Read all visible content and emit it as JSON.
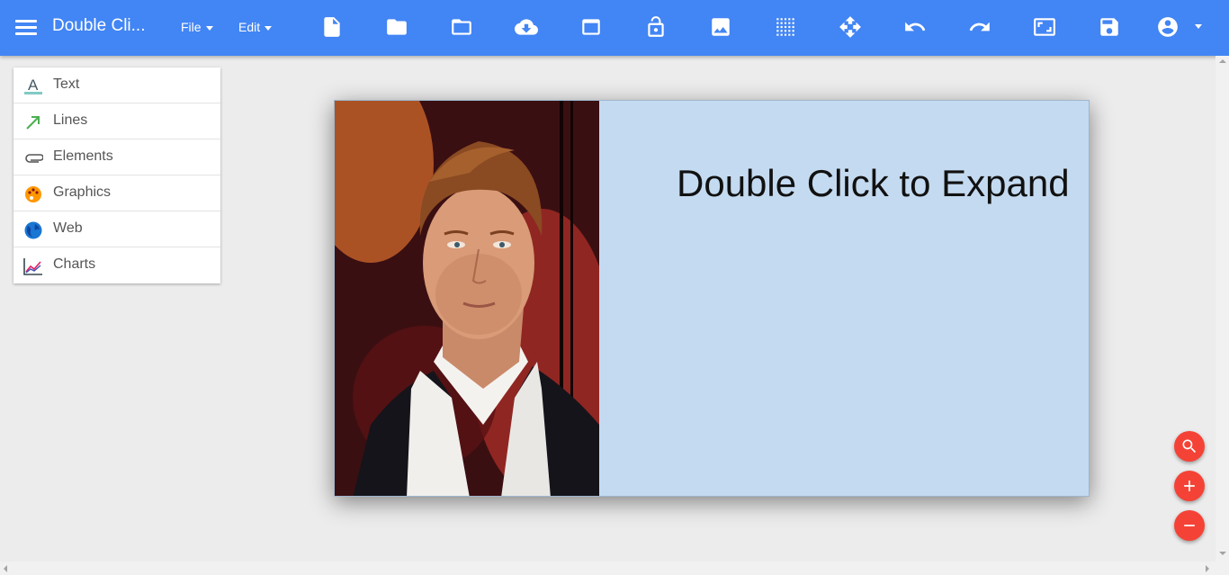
{
  "colors": {
    "toolbar": "#4285f4",
    "slide_background": "#c4daf0",
    "fab": "#f44336",
    "workspace": "#ececec"
  },
  "header": {
    "title": "Double Cli...",
    "menus": [
      {
        "label": "File"
      },
      {
        "label": "Edit"
      }
    ],
    "tools": [
      "new-document-icon",
      "folder-icon",
      "open-folder-icon",
      "cloud-download-icon",
      "window-icon",
      "unlock-icon",
      "image-icon",
      "grid-icon",
      "move-icon",
      "undo-icon",
      "redo-icon",
      "fit-screen-icon",
      "save-icon",
      "account-icon"
    ]
  },
  "sidebar": {
    "items": [
      {
        "label": "Text",
        "icon": "text-format-icon"
      },
      {
        "label": "Lines",
        "icon": "arrow-line-icon"
      },
      {
        "label": "Elements",
        "icon": "paperclip-icon"
      },
      {
        "label": "Graphics",
        "icon": "palette-icon"
      },
      {
        "label": "Web",
        "icon": "globe-icon"
      },
      {
        "label": "Charts",
        "icon": "line-chart-icon"
      }
    ]
  },
  "slide": {
    "title": "Double Click to Expand",
    "image": "portrait-photo"
  },
  "zoom": {
    "buttons": [
      "zoom-search-icon",
      "zoom-in-icon",
      "zoom-out-icon"
    ]
  }
}
